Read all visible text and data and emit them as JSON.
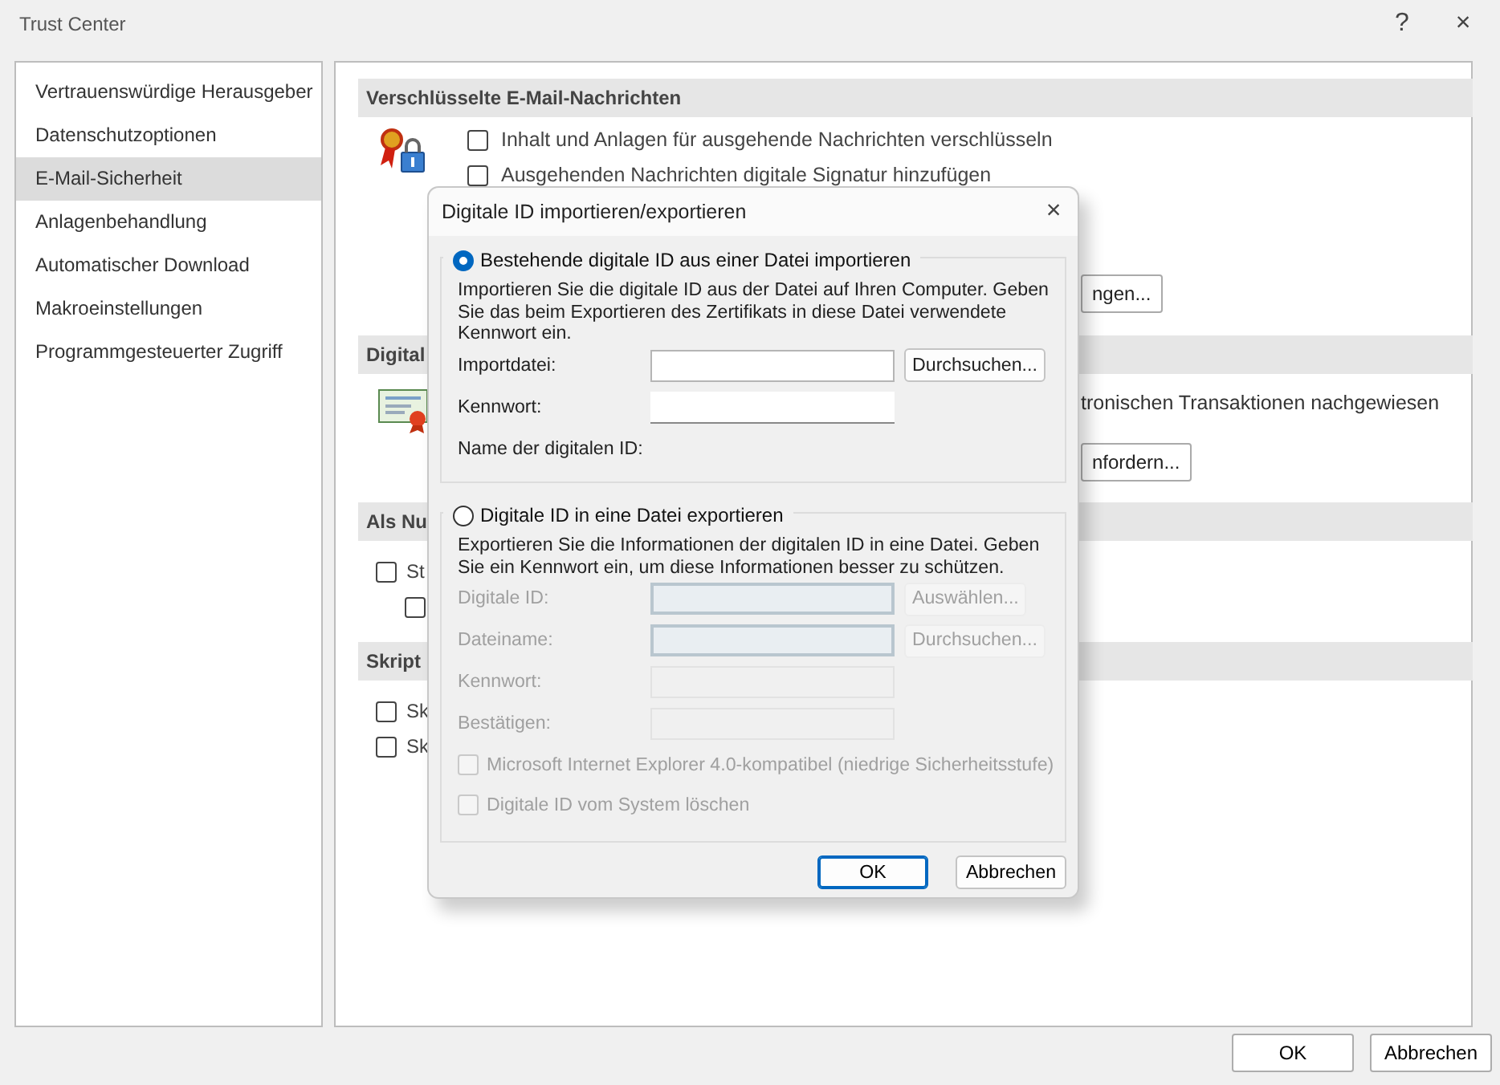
{
  "window": {
    "title": "Trust Center",
    "help": "?",
    "close": "×"
  },
  "sidebar": {
    "items": [
      {
        "label": "Vertrauenswürdige Herausgeber",
        "selected": false
      },
      {
        "label": "Datenschutzoptionen",
        "selected": false
      },
      {
        "label": "E-Mail-Sicherheit",
        "selected": true
      },
      {
        "label": "Anlagenbehandlung",
        "selected": false
      },
      {
        "label": "Automatischer Download",
        "selected": false
      },
      {
        "label": "Makroeinstellungen",
        "selected": false
      },
      {
        "label": "Programmgesteuerter Zugriff",
        "selected": false
      }
    ]
  },
  "sections": [
    {
      "title": "Verschlüsselte E-Mail-Nachrichten",
      "rows": [
        {
          "kind": "checkbox",
          "label": "Inhalt und Anlagen für ausgehende Nachrichten verschlüsseln",
          "checked": false
        },
        {
          "kind": "checkbox",
          "label": "Ausgehenden Nachrichten digitale Signatur hinzufügen",
          "checked": false
        },
        {
          "kind": "button",
          "label": "ngen..."
        }
      ]
    },
    {
      "title": "Digital",
      "rows": [
        {
          "kind": "text",
          "label": "tronischen Transaktionen nachgewiesen"
        },
        {
          "kind": "button",
          "label": "nfordern..."
        }
      ]
    },
    {
      "title": "Als Nu",
      "rows": [
        {
          "kind": "checkbox",
          "label": "St",
          "checked": false
        },
        {
          "kind": "subcheckbox",
          "checked": false
        }
      ]
    },
    {
      "title": "Skript",
      "rows": [
        {
          "kind": "checkbox",
          "label": "Sk",
          "checked": false
        },
        {
          "kind": "checkbox",
          "label": "Sk",
          "checked": false
        }
      ]
    }
  ],
  "footer": {
    "buttons": [
      {
        "label": "OK"
      },
      {
        "label": "Abbrechen"
      }
    ]
  },
  "dialog": {
    "title": "Digitale ID importieren/exportieren",
    "close": "×",
    "groups": [
      {
        "label": "Bestehende digitale ID aus einer Datei importieren",
        "selected": true,
        "disabled": false,
        "description": "Importieren Sie die digitale ID aus der Datei auf Ihren Computer. Geben Sie das beim Exportieren des Zertifikats in diese Datei verwendete Kennwort ein.",
        "fields": [
          {
            "kind": "input",
            "label": "Importdatei:",
            "button": "Durchsuchen..."
          },
          {
            "kind": "password",
            "label": "Kennwort:"
          },
          {
            "kind": "text",
            "label": "Name der digitalen ID:"
          }
        ]
      },
      {
        "label": "Digitale ID in eine Datei exportieren",
        "selected": false,
        "disabled": true,
        "description": "Exportieren Sie die Informationen der digitalen ID in eine Datei. Geben Sie ein Kennwort ein, um diese Informationen besser zu schützen.",
        "fields": [
          {
            "kind": "input",
            "label": "Digitale ID:",
            "button": "Auswählen..."
          },
          {
            "kind": "input",
            "label": "Dateiname:",
            "button": "Durchsuchen..."
          },
          {
            "kind": "password",
            "label": "Kennwort:"
          },
          {
            "kind": "password",
            "label": "Bestätigen:"
          }
        ],
        "options": [
          {
            "label": "Microsoft Internet Explorer 4.0-kompatibel (niedrige Sicherheitsstufe)",
            "checked": false
          },
          {
            "label": "Digitale ID vom System löschen",
            "checked": false
          }
        ]
      }
    ],
    "buttons": [
      {
        "label": "OK",
        "default": true
      },
      {
        "label": "Abbrechen",
        "default": false
      }
    ]
  }
}
